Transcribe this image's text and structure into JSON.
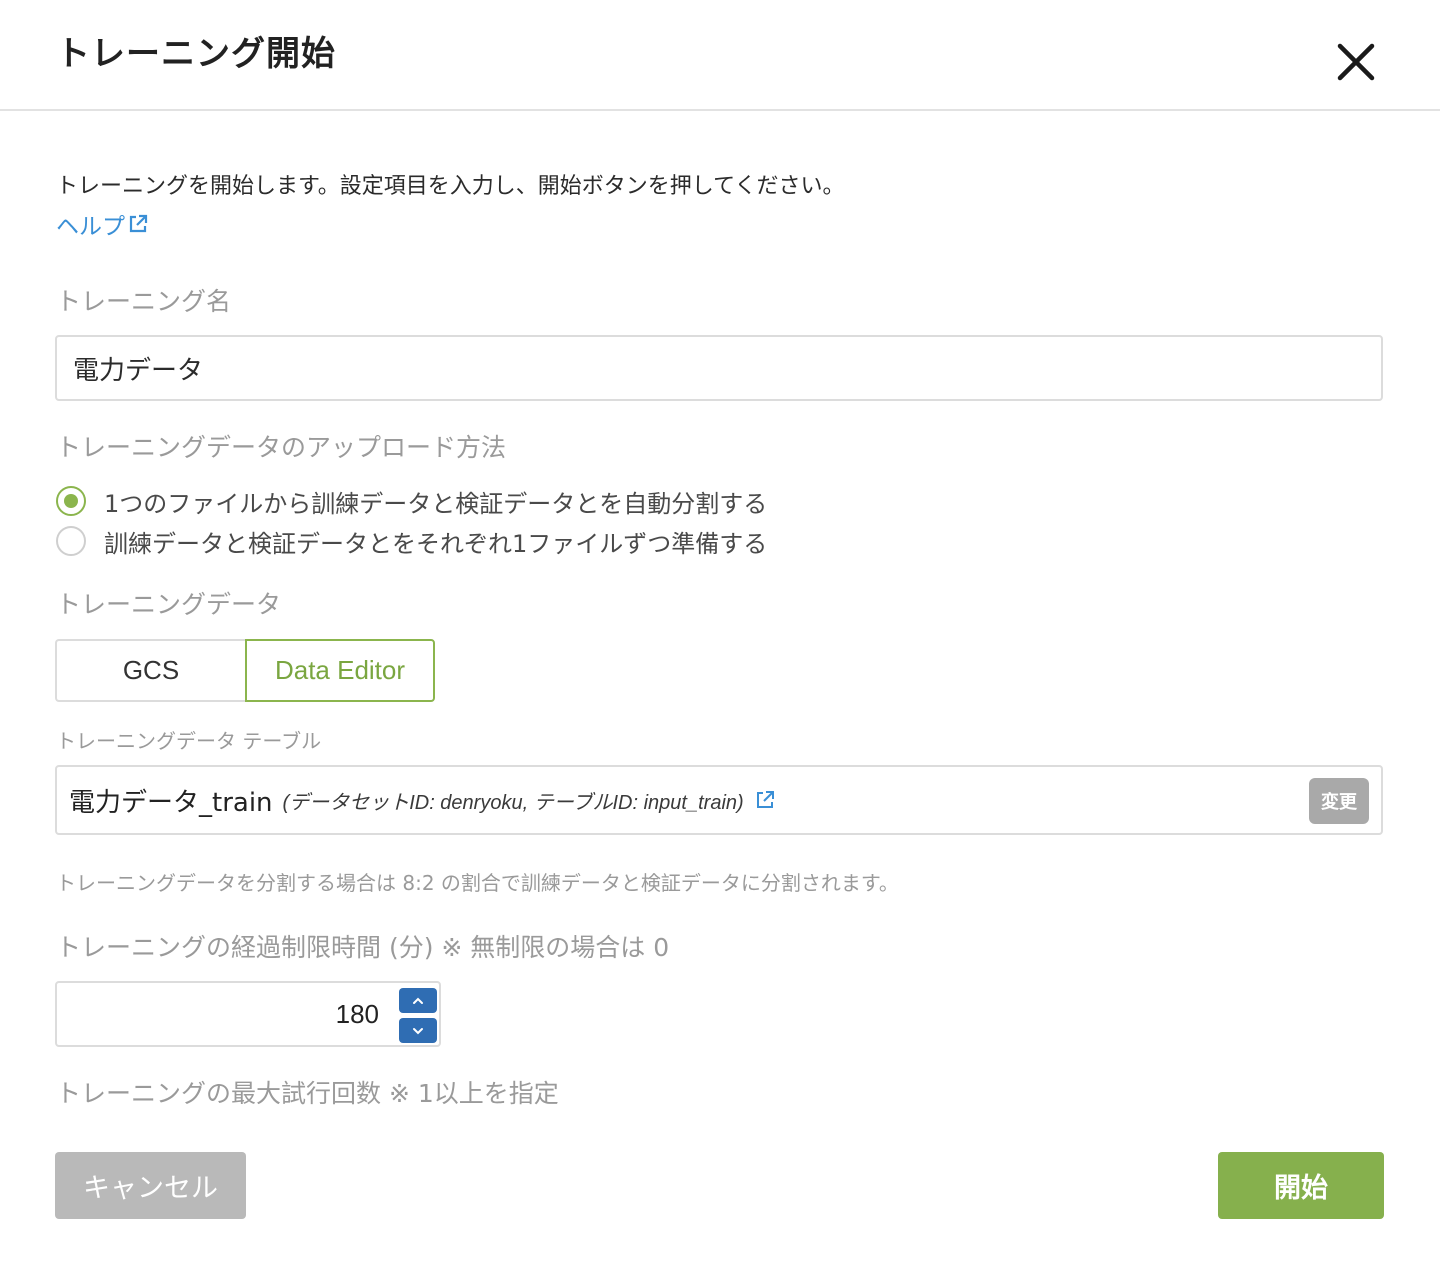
{
  "dialog": {
    "title": "トレーニング開始",
    "close_icon": "close-icon"
  },
  "intro": {
    "text": "トレーニングを開始します。設定項目を入力し、開始ボタンを押してください。",
    "help_label": "ヘルプ",
    "help_icon": "external-link-icon"
  },
  "training_name": {
    "label": "トレーニング名",
    "value": "電力データ"
  },
  "upload_method": {
    "label": "トレーニングデータのアップロード方法",
    "options": [
      {
        "label": "1つのファイルから訓練データと検証データとを自動分割する",
        "checked": true
      },
      {
        "label": "訓練データと検証データとをそれぞれ1ファイルずつ準備する",
        "checked": false
      }
    ]
  },
  "training_data": {
    "label": "トレーニングデータ",
    "tabs": [
      "GCS",
      "Data Editor"
    ],
    "selected_tab": "Data Editor",
    "table_label": "トレーニングデータ テーブル",
    "table_name": "電力データ_train",
    "table_meta": "(データセットID: denryoku, テーブルID: input_train)",
    "change_label": "変更",
    "split_note": "トレーニングデータを分割する場合は 8:2 の割合で訓練データと検証データに分割されます。"
  },
  "time_limit": {
    "label": "トレーニングの経過制限時間 (分) ※ 無制限の場合は 0",
    "value": "180"
  },
  "max_trials": {
    "label": "トレーニングの最大試行回数 ※ 1以上を指定"
  },
  "footer": {
    "cancel_label": "キャンセル",
    "start_label": "開始"
  },
  "colors": {
    "accent_green": "#86b04d",
    "link_blue": "#3a8fd6",
    "spinner_blue": "#2f6db3",
    "disabled_gray": "#b9b9b9"
  }
}
